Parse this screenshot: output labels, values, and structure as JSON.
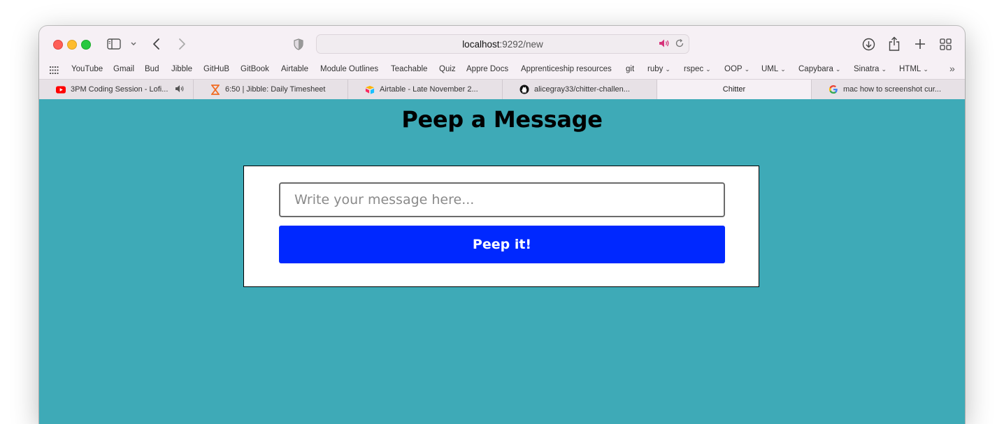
{
  "browser": {
    "url_host": "localhost",
    "url_rest": ":9292/new",
    "bookmarks": [
      {
        "label": "YouTube",
        "menu": false
      },
      {
        "label": "Gmail",
        "menu": false
      },
      {
        "label": "Bud",
        "menu": false
      },
      {
        "label": "Jibble",
        "menu": false
      },
      {
        "label": "GitHuB",
        "menu": false
      },
      {
        "label": "GitBook",
        "menu": false
      },
      {
        "label": "Airtable",
        "menu": false
      },
      {
        "label": "Module Outlines",
        "menu": false
      },
      {
        "label": "Teachable",
        "menu": false
      },
      {
        "label": "Quiz",
        "menu": false
      },
      {
        "label": "Appre Docs",
        "menu": false
      },
      {
        "label": "Apprenticeship resources",
        "menu": false
      },
      {
        "label": "git",
        "menu": false
      },
      {
        "label": "ruby",
        "menu": true
      },
      {
        "label": "rspec",
        "menu": true
      },
      {
        "label": "OOP",
        "menu": true
      },
      {
        "label": "UML",
        "menu": true
      },
      {
        "label": "Capybara",
        "menu": true
      },
      {
        "label": "Sinatra",
        "menu": true
      },
      {
        "label": "HTML",
        "menu": true
      }
    ],
    "tabs": [
      {
        "title": "3PM Coding Session - Lofi...",
        "icon": "youtube-icon",
        "audio": true,
        "active": false
      },
      {
        "title": "6:50 | Jibble: Daily Timesheet",
        "icon": "hourglass-icon",
        "audio": false,
        "active": false
      },
      {
        "title": "Airtable - Late November 2...",
        "icon": "airtable-icon",
        "audio": false,
        "active": false
      },
      {
        "title": "alicegray33/chitter-challen...",
        "icon": "github-icon",
        "audio": false,
        "active": false
      },
      {
        "title": "Chitter",
        "icon": "",
        "audio": false,
        "active": true
      },
      {
        "title": "mac how to screenshot cur...",
        "icon": "google-icon",
        "audio": false,
        "active": false
      }
    ]
  },
  "page": {
    "title": "Peep a Message",
    "message_placeholder": "Write your message here...",
    "submit_label": "Peep it!",
    "colors": {
      "background": "#3eaab7",
      "button": "#0028ff"
    }
  }
}
